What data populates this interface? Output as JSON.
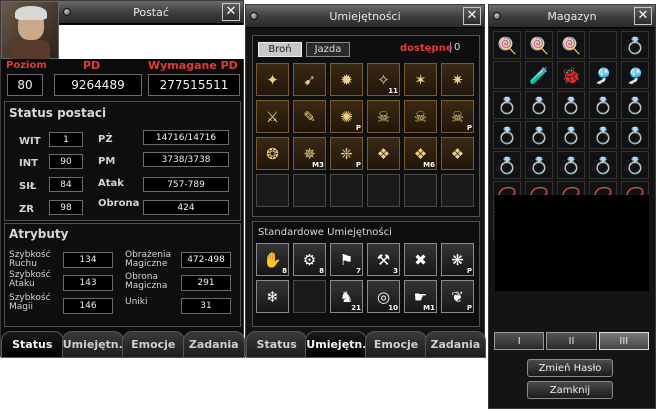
{
  "character": {
    "title": "Postać",
    "close_label": "✕",
    "level_label": "Poziom",
    "level_value": "80",
    "pd_label": "PD",
    "pd_value": "9264489",
    "req_pd_label": "Wymagane PD",
    "req_pd_value": "277515511",
    "status_header": "Status postaci",
    "stats": [
      {
        "label": "WIT",
        "value": "1"
      },
      {
        "label": "INT",
        "value": "90"
      },
      {
        "label": "SIŁ",
        "value": "84"
      },
      {
        "label": "ZR",
        "value": "98"
      }
    ],
    "stats_right": [
      {
        "label": "PŻ",
        "value": "14716/14716"
      },
      {
        "label": "PM",
        "value": "3738/3738"
      },
      {
        "label": "Atak",
        "value": "757-789"
      },
      {
        "label": "Obrona",
        "value": "424"
      }
    ],
    "attr_header": "Atrybuty",
    "attrs_left": [
      {
        "label": "Szybkość Ruchu",
        "value": "134"
      },
      {
        "label": "Szybkość Ataku",
        "value": "143"
      },
      {
        "label": "Szybkość Magii",
        "value": "146"
      }
    ],
    "attrs_right": [
      {
        "label": "Obrażenia Magiczne",
        "value": "472-498"
      },
      {
        "label": "Obrona Magiczna",
        "value": "291"
      },
      {
        "label": "Uniki",
        "value": "31"
      }
    ],
    "tabs": [
      "Status",
      "Umiejętn.",
      "Emocje",
      "Zadania"
    ]
  },
  "skills": {
    "title": "Umiejętności",
    "close_label": "✕",
    "subtab_weapon": "Broń",
    "subtab_riding": "Jazda",
    "available_label": "dostępne",
    "available_value": "0",
    "skill_rows": [
      [
        {
          "icon": "✦",
          "lvl": ""
        },
        {
          "icon": "➹",
          "lvl": ""
        },
        {
          "icon": "✹",
          "lvl": ""
        },
        {
          "icon": "✧",
          "lvl": "11"
        },
        {
          "icon": "✶",
          "lvl": ""
        },
        {
          "icon": "✷",
          "lvl": ""
        }
      ],
      [
        {
          "icon": "⚔",
          "lvl": ""
        },
        {
          "icon": "✎",
          "lvl": ""
        },
        {
          "icon": "✺",
          "lvl": "P"
        },
        {
          "icon": "☠",
          "lvl": ""
        },
        {
          "icon": "☠",
          "lvl": ""
        },
        {
          "icon": "☠",
          "lvl": "P"
        }
      ],
      [
        {
          "icon": "❂",
          "lvl": ""
        },
        {
          "icon": "✵",
          "lvl": "M3"
        },
        {
          "icon": "❈",
          "lvl": "P"
        },
        {
          "icon": "❖",
          "lvl": ""
        },
        {
          "icon": "❖",
          "lvl": "M6"
        },
        {
          "icon": "❖",
          "lvl": ""
        }
      ],
      [
        {
          "icon": "",
          "lvl": ""
        },
        {
          "icon": "",
          "lvl": ""
        },
        {
          "icon": "",
          "lvl": ""
        },
        {
          "icon": "",
          "lvl": ""
        },
        {
          "icon": "",
          "lvl": ""
        },
        {
          "icon": "",
          "lvl": ""
        }
      ]
    ],
    "std_header": "Standardowe Umiejętności",
    "std_rows": [
      [
        {
          "icon": "✋",
          "lvl": "8"
        },
        {
          "icon": "⚙",
          "lvl": "8"
        },
        {
          "icon": "⚑",
          "lvl": "7"
        },
        {
          "icon": "⚒",
          "lvl": "3"
        },
        {
          "icon": "✖",
          "lvl": ""
        },
        {
          "icon": "❋",
          "lvl": "P"
        }
      ],
      [
        {
          "icon": "❄",
          "lvl": ""
        },
        {
          "icon": "",
          "lvl": ""
        },
        {
          "icon": "♞",
          "lvl": "21"
        },
        {
          "icon": "◎",
          "lvl": "10"
        },
        {
          "icon": "☛",
          "lvl": "M1"
        },
        {
          "icon": "❦",
          "lvl": "P"
        }
      ]
    ],
    "tabs": [
      "Status",
      "Umiejętn.",
      "Emocje",
      "Zadania"
    ]
  },
  "storage": {
    "title": "Magazyn",
    "close_label": "✕",
    "rows": [
      [
        "🍭",
        "🍭",
        "🍭",
        "",
        "💍"
      ],
      [
        "",
        "🧪",
        "🐞",
        "🎐",
        "🎐"
      ],
      [
        "💍",
        "💍",
        "💍",
        "💍",
        "💍"
      ],
      [
        "💍",
        "💍",
        "💍",
        "💍",
        "💍"
      ],
      [
        "💍",
        "💍",
        "💍",
        "💍",
        "💍"
      ],
      [
        "📿",
        "📿",
        "📿",
        "📿",
        "📿"
      ],
      [
        "",
        "",
        "",
        "",
        "🔑"
      ]
    ],
    "pages": [
      "I",
      "II",
      "III"
    ],
    "change_password_label": "Zmień Hasło",
    "close_button_label": "Zamknij"
  }
}
